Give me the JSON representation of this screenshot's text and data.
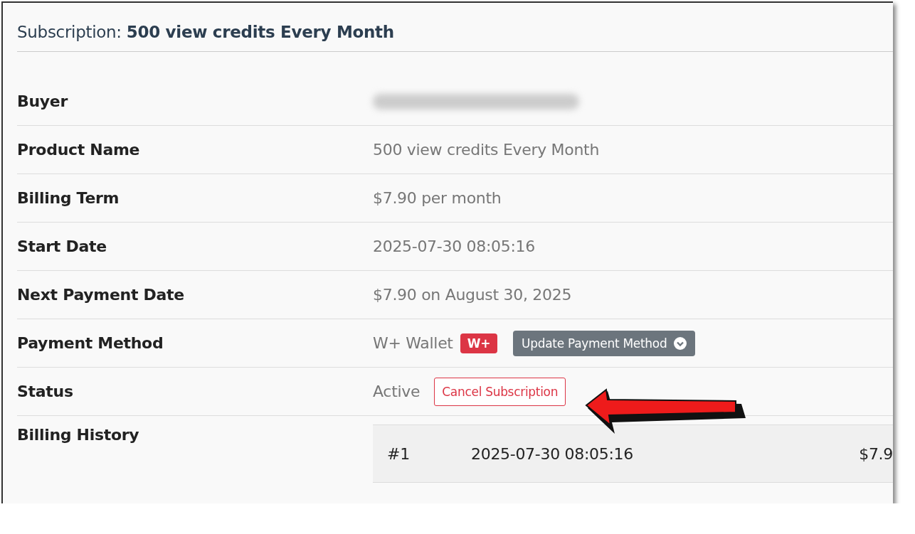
{
  "title": "Subscription: **500 view credits Every Month**",
  "rows": [
    {
      "kind": "redacted",
      "label": "Buyer"
    },
    {
      "kind": "text",
      "label": "Product Name",
      "value": "500 view credits Every Month"
    },
    {
      "kind": "text",
      "label": "Billing Term",
      "value": "$7.90 per month"
    },
    {
      "kind": "text",
      "label": "Start Date",
      "value": "2025-07-30 08:05:16"
    },
    {
      "kind": "text",
      "label": "Next Payment Date",
      "value": "$7.90 on August 30, 2025"
    },
    {
      "kind": "payment",
      "label": "Payment Method",
      "value": "W+ Wallet",
      "badge": "W+",
      "button": "Update Payment Method"
    },
    {
      "kind": "status",
      "label": "Status",
      "value": "Active",
      "button": "Cancel Subscription"
    },
    {
      "kind": "history",
      "label": "Billing History",
      "entries": [
        {
          "number": "#1",
          "date": "2025-07-30 08:05:16",
          "amount": "$7.9"
        }
      ]
    }
  ]
}
